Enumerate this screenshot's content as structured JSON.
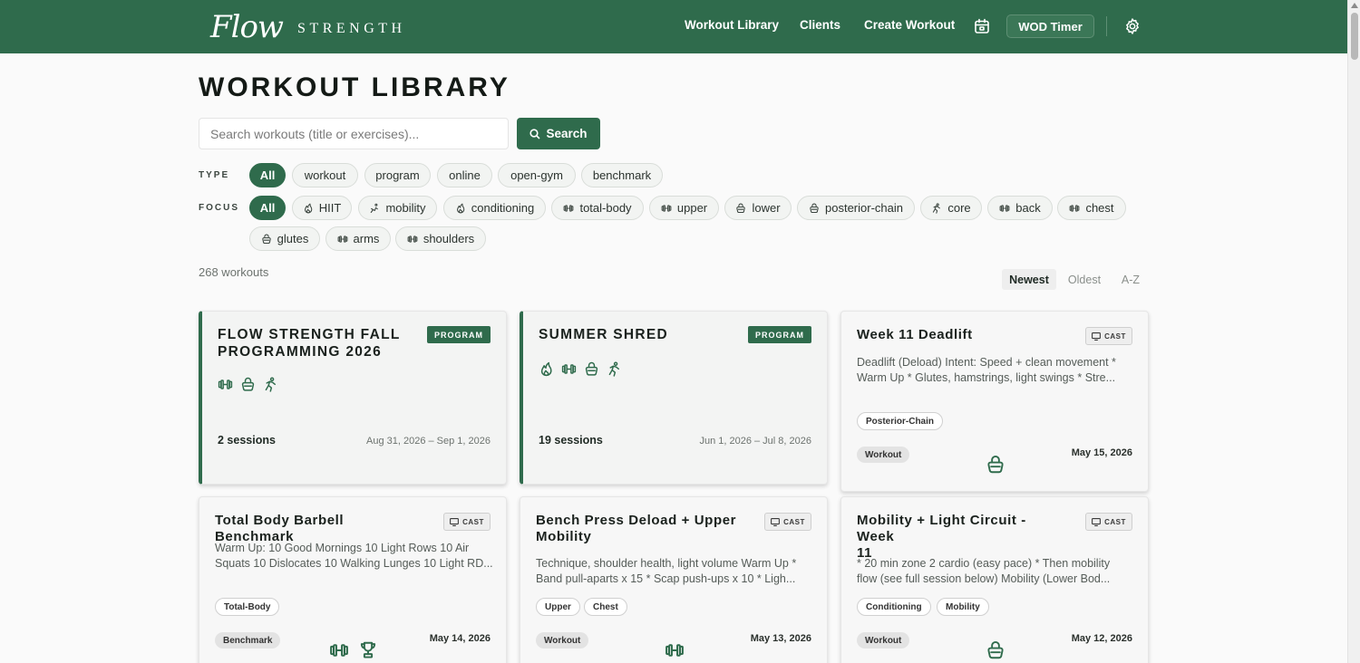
{
  "header": {
    "logo_script": "Flow",
    "logo_word": "STRENGTH",
    "nav": [
      {
        "label": "Workout Library"
      },
      {
        "label": "Clients"
      },
      {
        "label": "Create Workout"
      }
    ],
    "calendar_icon": "calendar-icon",
    "wod_label": "WOD Timer",
    "settings_icon": "gear-icon"
  },
  "page": {
    "title": "WORKOUT LIBRARY",
    "search_placeholder": "Search workouts (title or exercises)...",
    "search_label": "Search",
    "search_icon": "search-icon"
  },
  "filters": {
    "type_label": "TYPE",
    "type_chips": [
      "All",
      "workout",
      "program",
      "online",
      "open-gym",
      "benchmark"
    ],
    "focus_label": "FOCUS",
    "focus_chips": [
      {
        "label": "All",
        "icon": ""
      },
      {
        "label": "HIIT",
        "icon": "flame-icon"
      },
      {
        "label": "mobility",
        "icon": "stretch-icon"
      },
      {
        "label": "conditioning",
        "icon": "flame-icon"
      },
      {
        "label": "total-body",
        "icon": "dumbbell-icon"
      },
      {
        "label": "upper",
        "icon": "dumbbell-icon"
      },
      {
        "label": "lower",
        "icon": "kettlebell-icon"
      },
      {
        "label": "posterior-chain",
        "icon": "kettlebell-icon"
      },
      {
        "label": "core",
        "icon": "figure-icon"
      },
      {
        "label": "back",
        "icon": "dumbbell-icon"
      },
      {
        "label": "chest",
        "icon": "dumbbell-icon"
      },
      {
        "label": "glutes",
        "icon": "kettlebell-icon"
      },
      {
        "label": "arms",
        "icon": "dumbbell-icon"
      },
      {
        "label": "shoulders",
        "icon": "dumbbell-icon"
      }
    ],
    "active_color": "#2f6b4c"
  },
  "results": {
    "count": "268 workouts",
    "sort": [
      "Newest",
      "Oldest",
      "A-Z"
    ],
    "sort_active": "Newest"
  },
  "cards": [
    {
      "kind": "program",
      "title_lines": [
        "FLOW STRENGTH FALL",
        "PROGRAMMING 2026"
      ],
      "badge": "PROGRAM",
      "icons": [
        "dumbbell-icon",
        "kettlebell-icon",
        "figure-icon"
      ],
      "sessions": "2 sessions",
      "range": "Aug 31, 2026 – Sep 1, 2026"
    },
    {
      "kind": "program",
      "title_lines": [
        "SUMMER SHRED"
      ],
      "badge": "PROGRAM",
      "icons": [
        "flame-icon",
        "dumbbell-icon",
        "kettlebell-icon",
        "figure-icon"
      ],
      "sessions": "19 sessions",
      "range": "Jun 1, 2026 – Jul 8, 2026"
    },
    {
      "kind": "std",
      "title_lines": [
        "Week 11 Deadlift"
      ],
      "badge": "CAST",
      "desc_lines": [
        "Deadlift (Deload) Intent: Speed + clean movement *",
        "Warm Up * Glutes, hamstrings, light swings * Stre..."
      ],
      "tags": [
        "Posterior-Chain"
      ],
      "type": "Workout",
      "date": "May 15, 2026",
      "foot_icons": [
        "kettlebell-icon"
      ]
    },
    {
      "kind": "std",
      "title_lines": [
        "Total Body Barbell Benchmark"
      ],
      "badge": "CAST",
      "desc_lines": [
        "Warm Up: 10 Good Mornings 10 Light Rows 10 Air",
        "Squats 10 Dislocates 10 Walking Lunges 10 Light RD..."
      ],
      "tags": [
        "Total-Body"
      ],
      "type": "Benchmark",
      "date": "May 14, 2026",
      "foot_icons": [
        "dumbbell-icon",
        "trophy-icon"
      ]
    },
    {
      "kind": "std",
      "title_lines": [
        "Bench Press Deload + Upper",
        "Mobility"
      ],
      "badge": "CAST",
      "desc_lines": [
        "Technique, shoulder health, light volume Warm Up *",
        "Band pull-aparts x 15 * Scap push-ups x 10 * Ligh..."
      ],
      "tags": [
        "Upper",
        "Chest"
      ],
      "type": "Workout",
      "date": "May 13, 2026",
      "foot_icons": [
        "dumbbell-icon"
      ]
    },
    {
      "kind": "std",
      "title_lines": [
        "Mobility + Light Circuit - Week",
        "11"
      ],
      "badge": "CAST",
      "desc_lines": [
        "* 20 min zone 2 cardio (easy pace) * Then mobility",
        "flow (see full session below) Mobility (Lower Bod..."
      ],
      "tags": [
        "Conditioning",
        "Mobility"
      ],
      "type": "Workout",
      "date": "May 12, 2026",
      "foot_icons": [
        "kettlebell-icon"
      ]
    }
  ]
}
